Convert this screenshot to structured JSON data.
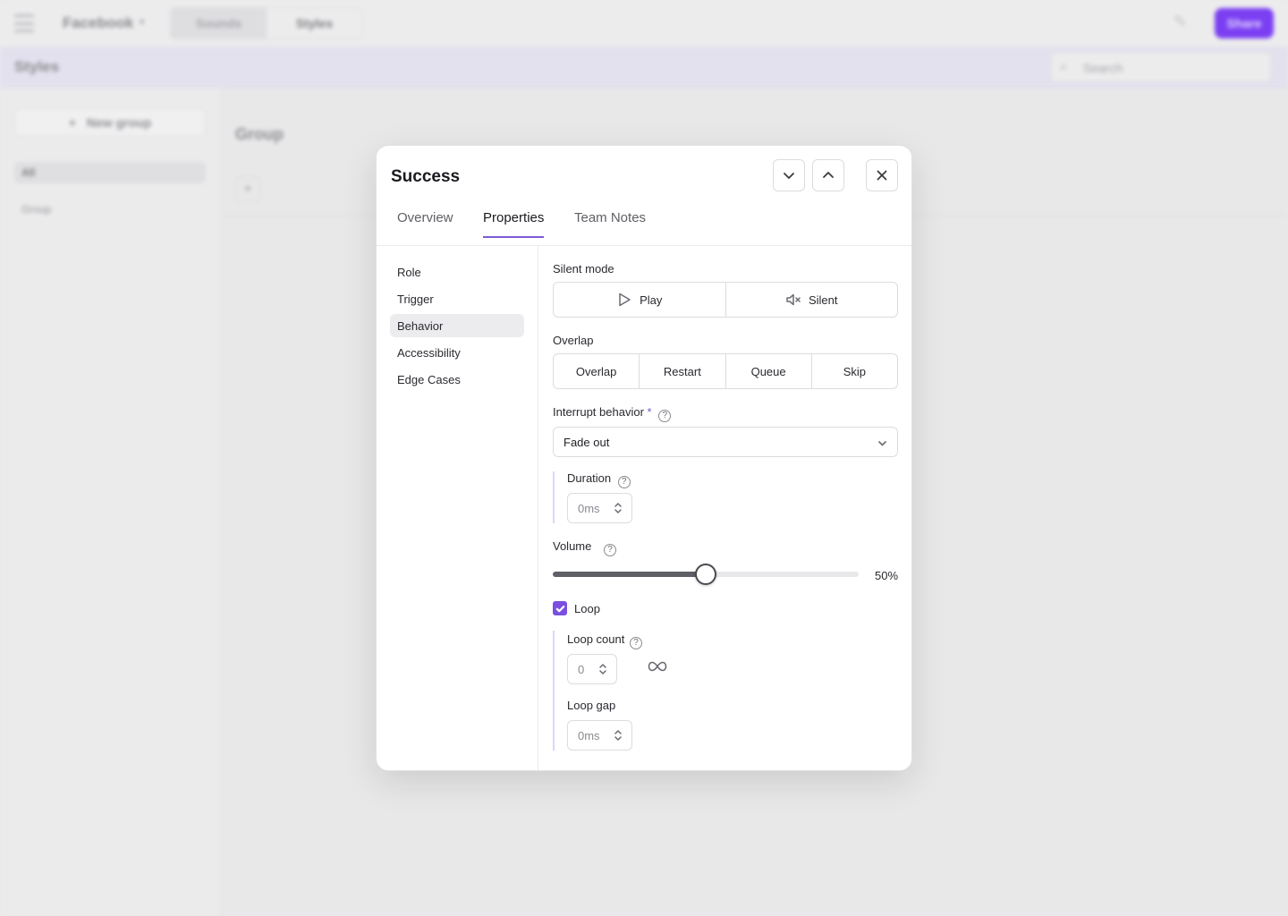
{
  "app": {
    "brand": "Facebook",
    "top_tabs": [
      "Sounds",
      "Styles"
    ],
    "share_label": "Share",
    "page_title": "Styles",
    "search_placeholder": "Search",
    "new_group_label": "New group",
    "sidebar_items": [
      "All",
      "Group"
    ],
    "group_title": "Group"
  },
  "modal": {
    "title": "Success",
    "tabs": [
      "Overview",
      "Properties",
      "Team Notes"
    ],
    "active_tab": "Properties",
    "nav": [
      "Role",
      "Trigger",
      "Behavior",
      "Accessibility",
      "Edge Cases"
    ],
    "active_nav": "Behavior",
    "silent_mode": {
      "label": "Silent mode",
      "options": [
        "Play",
        "Silent"
      ]
    },
    "overlap": {
      "label": "Overlap",
      "options": [
        "Overlap",
        "Restart",
        "Queue",
        "Skip"
      ]
    },
    "interrupt": {
      "label": "Interrupt behavior",
      "required_mark": "*",
      "value": "Fade out"
    },
    "duration": {
      "label": "Duration",
      "value": "0ms"
    },
    "volume": {
      "label": "Volume",
      "value": 50,
      "display": "50%"
    },
    "loop": {
      "label": "Loop",
      "checked": true
    },
    "loop_count": {
      "label": "Loop count",
      "value": "0"
    },
    "loop_gap": {
      "label": "Loop gap",
      "value": "0ms"
    }
  },
  "colors": {
    "accent": "#7b5bd6",
    "share_button": "#7b3ff2",
    "checkbox": "#7b4fe0"
  }
}
